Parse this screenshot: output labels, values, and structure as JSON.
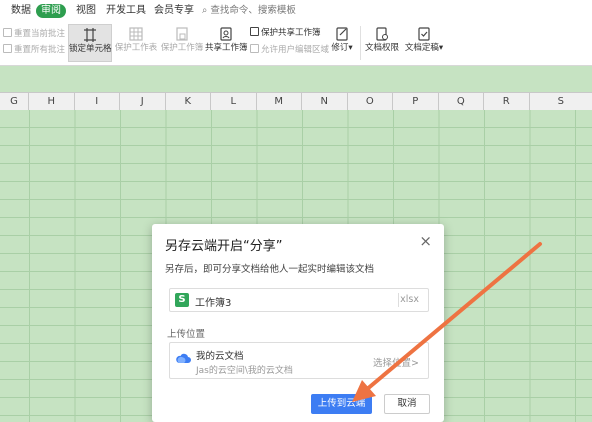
{
  "tabs": [
    {
      "label": "数据"
    },
    {
      "label": "审阅",
      "active": true
    },
    {
      "label": "视图"
    },
    {
      "label": "开发工具"
    },
    {
      "label": "会员专享"
    }
  ],
  "search": {
    "placeholder": "查找命令、搜索模板"
  },
  "toolbar": {
    "reset_current_comment": "重置当前批注",
    "reset_all_comments": "重置所有批注",
    "lock_cell": "锁定单元格",
    "protect_sheet": "保护工作表",
    "protect_workbook": "保护工作簿",
    "share_workbook": "共享工作簿",
    "protect_shared_workbook": "保护共享工作簿",
    "allow_edit_ranges": "允许用户编辑区域",
    "track_changes": "修订",
    "document_rights": "文档权限",
    "finalize_document": "文档定稿"
  },
  "columns": [
    "G",
    "H",
    "I",
    "J",
    "K",
    "L",
    "M",
    "N",
    "O",
    "P",
    "Q",
    "R",
    "S"
  ],
  "dialog": {
    "title": "另存云端开启“分享”",
    "description": "另存后，即可分享文档给他人一起实时编辑该文档",
    "file_name": "工作簿3",
    "file_ext": "xlsx",
    "upload_location_label": "上传位置",
    "location_name": "我的云文档",
    "location_path": "Jas的云空间\\我的云文档",
    "change_location": "选择位置>",
    "upload_button": "上传到云端",
    "cancel_button": "取消"
  },
  "colors": {
    "accent": "#2e9e4f",
    "primary_button": "#3d7df3",
    "annotation_arrow": "#ee7342",
    "sheet_bg": "#c6e3c2"
  }
}
